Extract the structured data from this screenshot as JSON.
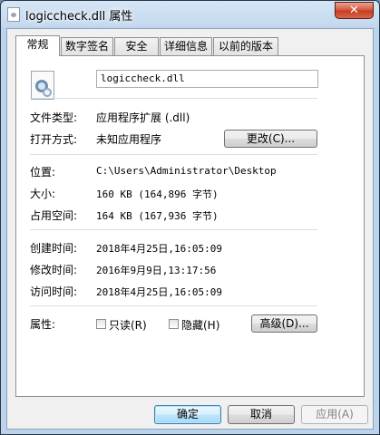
{
  "window": {
    "title": "logiccheck.dll 属性",
    "close_glyph": "✕"
  },
  "tabs": [
    {
      "label": "常规",
      "active": true
    },
    {
      "label": "数字签名"
    },
    {
      "label": "安全"
    },
    {
      "label": "详细信息"
    },
    {
      "label": "以前的版本"
    }
  ],
  "general": {
    "file_name": "logiccheck.dll",
    "file_type": {
      "label": "文件类型:",
      "value": "应用程序扩展 (.dll)"
    },
    "opens_with": {
      "label": "打开方式:",
      "value": "未知应用程序",
      "button": "更改(C)..."
    },
    "location": {
      "label": "位置:",
      "value": "C:\\Users\\Administrator\\Desktop"
    },
    "size": {
      "label": "大小:",
      "value": "160 KB (164,896 字节)"
    },
    "size_on_disk": {
      "label": "占用空间:",
      "value": "164 KB (167,936 字节)"
    },
    "created": {
      "label": "创建时间:",
      "value": "2018年4月25日,16:05:09"
    },
    "modified": {
      "label": "修改时间:",
      "value": "2016年9月9日,13:17:56"
    },
    "accessed": {
      "label": "访问时间:",
      "value": "2018年4月25日,16:05:09"
    },
    "attributes": {
      "label": "属性:",
      "readonly": "只读(R)",
      "hidden": "隐藏(H)",
      "advanced_button": "高级(D)..."
    }
  },
  "footer": {
    "ok": "确定",
    "cancel": "取消",
    "apply": "应用(A)"
  }
}
